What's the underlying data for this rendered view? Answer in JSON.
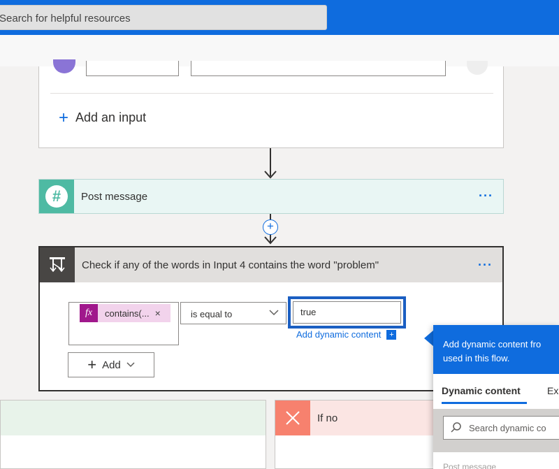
{
  "topbar": {
    "search_placeholder": "Search for helpful resources"
  },
  "trigger": {
    "add_input_label": "Add an input"
  },
  "post_message": {
    "title": "Post message",
    "more_label": "···"
  },
  "insert_step": {
    "label": "+"
  },
  "condition": {
    "title": "Check if any of the words in Input 4 contains the word \"problem\"",
    "more_label": "···",
    "expression": {
      "icon_text": "fx",
      "label": "contains(...",
      "remove": "×"
    },
    "operator": "is equal to",
    "value": "true",
    "add_dynamic_label": "Add dynamic content",
    "add_button_label": "Add"
  },
  "branches": {
    "no_label": "If no"
  },
  "dynamic_panel": {
    "header_line1": "Add dynamic content fro",
    "header_line2": "used in this flow.",
    "tabs": [
      "Dynamic content",
      "Exp"
    ],
    "search_placeholder": "Search dynamic co",
    "section_label": "Post message"
  },
  "colors": {
    "accent": "#0f6cde",
    "slack_green": "#4ebaa3",
    "expression_purple": "#a0188c",
    "no_branch_red": "#f7816e"
  },
  "icons": {
    "slack": "slack-icon",
    "condition": "condition-icon",
    "no": "close-icon",
    "search": "search-icon"
  }
}
